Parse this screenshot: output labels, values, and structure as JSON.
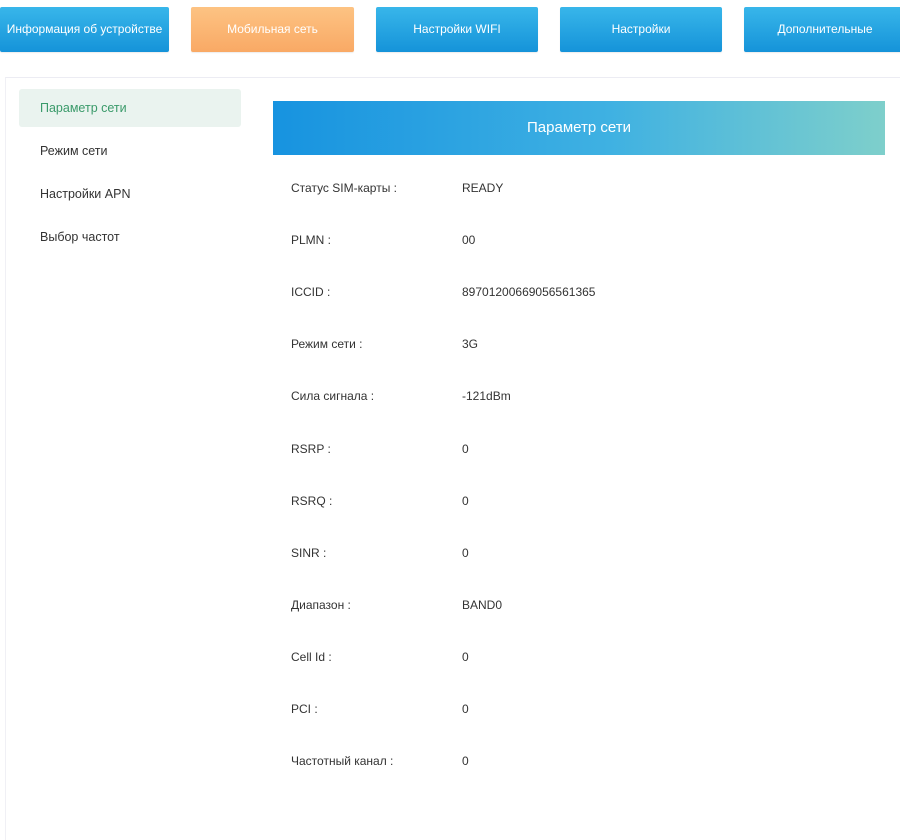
{
  "top_nav": [
    {
      "label": "Информация об устройстве",
      "active": false
    },
    {
      "label": "Мобильная сеть",
      "active": true
    },
    {
      "label": "Настройки WIFI",
      "active": false
    },
    {
      "label": "Настройки",
      "active": false
    },
    {
      "label": "Дополнительные",
      "active": false
    }
  ],
  "sidebar": {
    "items": [
      {
        "label": "Параметр сети",
        "active": true
      },
      {
        "label": "Режим сети",
        "active": false
      },
      {
        "label": "Настройки APN",
        "active": false
      },
      {
        "label": "Выбор частот",
        "active": false
      }
    ]
  },
  "panel": {
    "title": "Параметр сети",
    "rows": [
      {
        "label": "Статус SIM-карты :",
        "value": "READY"
      },
      {
        "label": "PLMN :",
        "value": "00"
      },
      {
        "label": "ICCID :",
        "value": "89701200669056561365"
      },
      {
        "label": "Режим сети :",
        "value": "3G"
      },
      {
        "label": "Сила сигнала :",
        "value": "-121dBm"
      },
      {
        "label": "RSRP :",
        "value": "0"
      },
      {
        "label": "RSRQ :",
        "value": "0"
      },
      {
        "label": "SINR :",
        "value": "0"
      },
      {
        "label": "Диапазон :",
        "value": "BAND0"
      },
      {
        "label": "Cell Id :",
        "value": "0"
      },
      {
        "label": "PCI :",
        "value": "0"
      },
      {
        "label": "Частотный канал :",
        "value": "0"
      }
    ]
  },
  "colors": {
    "nav_blue": "#1593d9",
    "nav_active_orange": "#f9a965",
    "sidebar_active_bg": "#eaf3ef",
    "sidebar_active_text": "#3a9a6a"
  }
}
